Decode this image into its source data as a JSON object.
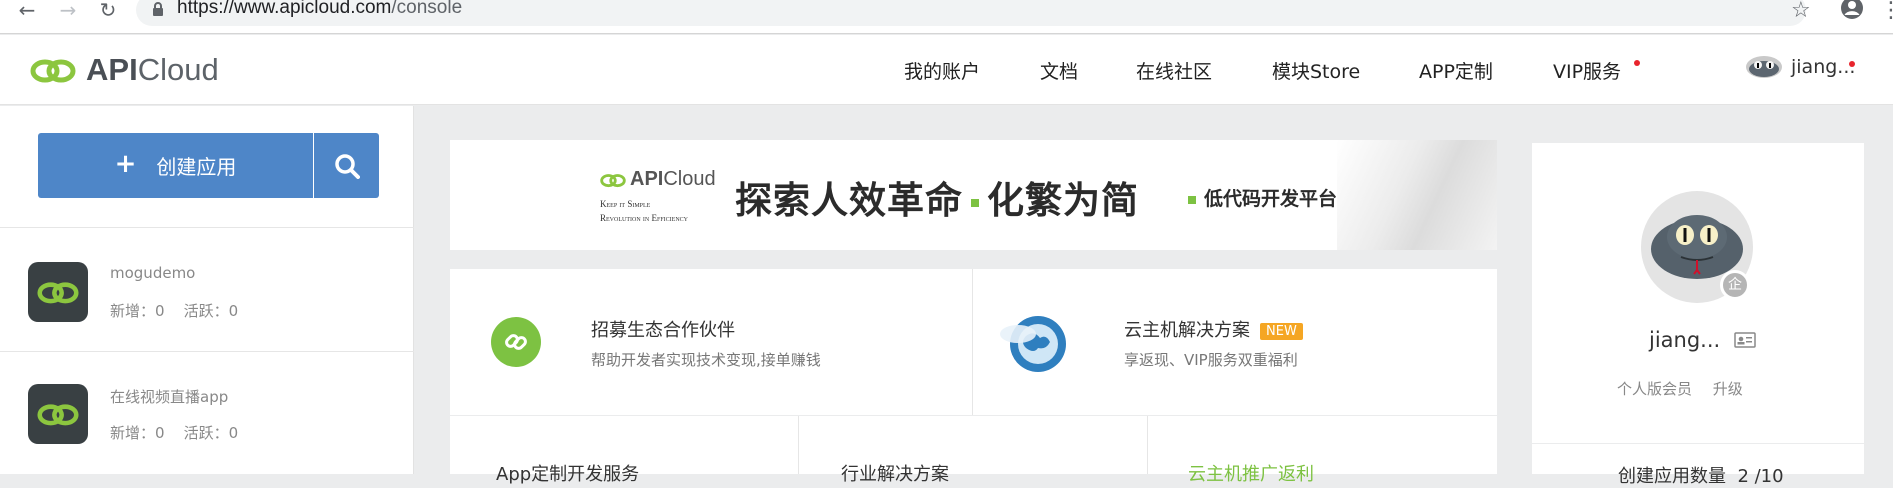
{
  "browser": {
    "url_host": "https://www.apicloud.com",
    "url_path": "/console"
  },
  "header": {
    "logo_api": "API",
    "logo_cloud": "Cloud",
    "nav": [
      "我的账户",
      "文档",
      "在线社区",
      "模块Store",
      "APP定制",
      "VIP服务"
    ],
    "username": "jiang..."
  },
  "sidebar": {
    "create_label": "创建应用",
    "apps": [
      {
        "name": "mogudemo",
        "stats": "新增：0    活跃：0"
      },
      {
        "name": "在线视频直播app",
        "stats": "新增：0    活跃：0"
      }
    ]
  },
  "banner": {
    "logo_api": "API",
    "logo_cloud": "Cloud",
    "tagline1": "Keep it Simple",
    "tagline2": "Revolution in Efficiency",
    "title_part1": "探索人效革命",
    "title_part2": "化繁为简",
    "subtitle": "低代码开发平台"
  },
  "cards": [
    {
      "title": "招募生态合作伙伴",
      "desc": "帮助开发者实现技术变现,接单赚钱"
    },
    {
      "title": "云主机解决方案",
      "badge": "NEW",
      "desc": "享返现、VIP服务双重福利"
    }
  ],
  "row2": [
    "App定制开发服务",
    "行业解决方案",
    "云主机推广返利"
  ],
  "profile": {
    "enterprise_badge": "企",
    "name": "jiang...",
    "member_type": "个人版会员",
    "upgrade": "升级",
    "app_count": "创建应用数量  2 /10"
  },
  "colors": {
    "primary_blue": "#4e86c8",
    "brand_green": "#7dc242",
    "badge_orange": "#f5a623",
    "notify_red": "#e8252d"
  }
}
